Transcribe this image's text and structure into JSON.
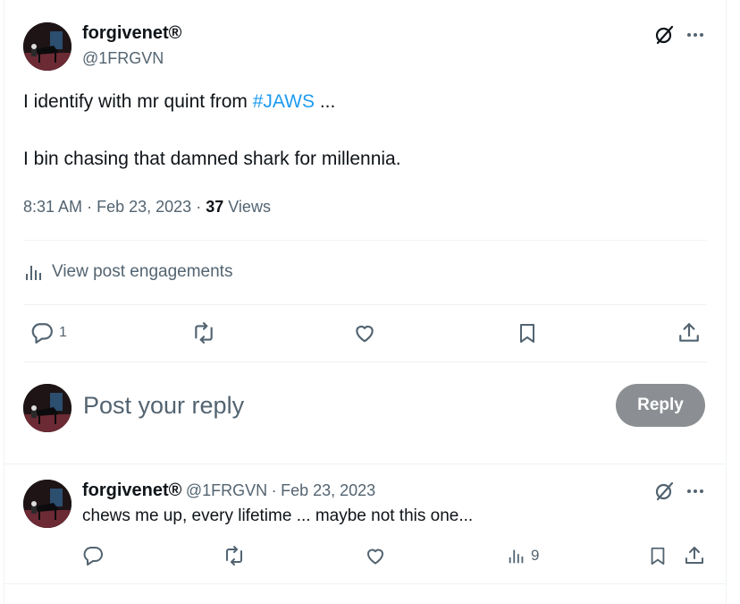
{
  "post": {
    "author": {
      "name": "forgivenet®",
      "handle": "@1FRGVN"
    },
    "text_line1_prefix": "I identify with mr quint from ",
    "hashtag": "#JAWS",
    "text_line1_suffix": " ...",
    "text_line2": "I bin chasing that damned shark for millennia.",
    "time": "8:31 AM",
    "date": "Feb 23, 2023",
    "views_count": "37",
    "views_label": "Views",
    "sep": "·",
    "engagements_label": "View post engagements",
    "reply_count": "1"
  },
  "composer": {
    "placeholder": "Post your reply",
    "reply_button": "Reply"
  },
  "reply": {
    "author": {
      "name": "forgivenet®",
      "handle": "@1FRGVN"
    },
    "date": "Feb 23, 2023",
    "sep": "·",
    "text": "chews me up, every lifetime ... maybe not this one...",
    "views_count": "9"
  },
  "icons": {
    "grok": "grok-icon",
    "more": "more-icon",
    "analytics": "analytics-icon",
    "reply": "reply-icon",
    "repost": "repost-icon",
    "like": "heart-icon",
    "bookmark": "bookmark-icon",
    "share": "share-icon"
  },
  "colors": {
    "accent": "#1d9bf0",
    "muted": "#536471",
    "text": "#0f1419",
    "disabled_button": "#8b8f93"
  }
}
